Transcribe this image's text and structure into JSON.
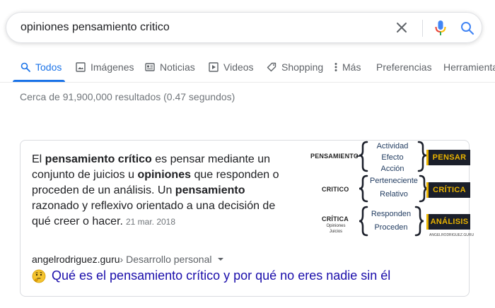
{
  "search": {
    "query": "opiniones pensamiento critico"
  },
  "tabs": [
    {
      "label": "Todos",
      "icon": "search-icon",
      "active": true
    },
    {
      "label": "Imágenes",
      "icon": "image-icon"
    },
    {
      "label": "Noticias",
      "icon": "news-icon"
    },
    {
      "label": "Videos",
      "icon": "play-icon"
    },
    {
      "label": "Shopping",
      "icon": "tag-icon"
    },
    {
      "label": "Más",
      "icon": "more-vert-icon"
    },
    {
      "label": "Preferencias"
    },
    {
      "label": "Herramientas"
    }
  ],
  "stats": "Cerca de 91,900,000 resultados (0.47 segundos)",
  "snippet": {
    "p1": "El ",
    "b1": "pensamiento crítico",
    "p2": " es pensar mediante un conjunto de juicios u ",
    "b2": "opiniones",
    "p3": " que responden o proceden de un análisis. Un ",
    "b3": "pensamiento",
    "p4": " razonado y reflexivo orientado a una decisión de qué creer o hacer.",
    "date": "21 mar. 2018"
  },
  "diagram": {
    "rows": [
      {
        "label": "PENSAMIENTO",
        "items": [
          "Actividad",
          "Efecto",
          "Acción"
        ],
        "box": "PENSAR"
      },
      {
        "label": "CRITICO",
        "items": [
          "Perteneciente",
          "Relativo"
        ],
        "box": "CRÍTICA"
      },
      {
        "label": "CRÍTICA",
        "sub": [
          "Opiniones",
          "Juicios"
        ],
        "items": [
          "Responden",
          "Proceden"
        ],
        "box": "ANÁLISIS"
      }
    ],
    "credit": "ANGELRODRIGUEZ.GURU"
  },
  "result": {
    "domain": "angelrodriguez.guru",
    "path": " › Desarrollo personal",
    "title": "Qué es el pensamiento crítico y por qué no eres nadie sin él"
  },
  "colors": {
    "link": "#1a0dab",
    "accent": "#1a73e8",
    "box_bg": "#1b1f2a",
    "box_text": "#e9b300"
  }
}
